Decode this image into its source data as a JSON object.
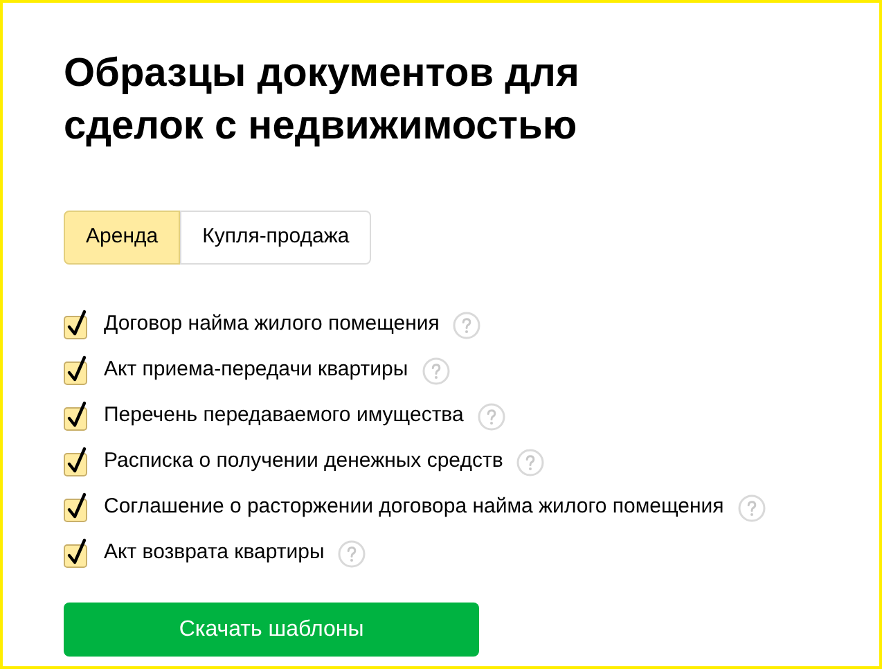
{
  "title": "Образцы документов для сделок с недвижимостью",
  "tabs": [
    {
      "label": "Аренда",
      "selected": true
    },
    {
      "label": "Купля-продажа",
      "selected": false
    }
  ],
  "documents": [
    {
      "label": "Договор найма жилого помещения",
      "checked": true
    },
    {
      "label": "Акт приема-передачи квартиры",
      "checked": true
    },
    {
      "label": "Перечень передаваемого имущества",
      "checked": true
    },
    {
      "label": "Расписка о получении денежных средств",
      "checked": true
    },
    {
      "label": "Соглашение о расторжении договора найма жилого помещения",
      "checked": true
    },
    {
      "label": "Акт возврата квартиры",
      "checked": true
    }
  ],
  "download_button": "Скачать шаблоны"
}
